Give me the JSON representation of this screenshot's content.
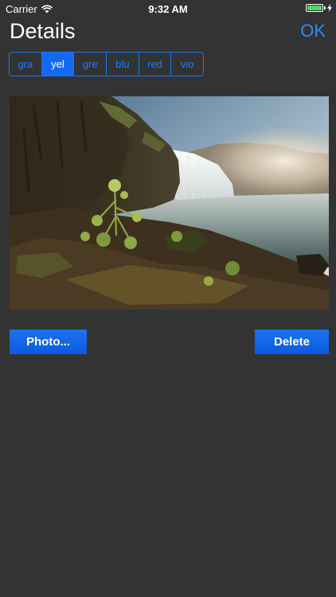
{
  "status_bar": {
    "carrier": "Carrier",
    "time": "9:32 AM",
    "battery_level": 1.0,
    "icons": [
      "wifi-icon",
      "battery-icon",
      "charging-bolt-icon"
    ]
  },
  "nav": {
    "title": "Details",
    "ok_label": "OK"
  },
  "color_segments": {
    "items": [
      "gra",
      "yel",
      "gre",
      "blu",
      "red",
      "vio"
    ],
    "selected_index": 1
  },
  "photo": {
    "subject": "waterfall landscape"
  },
  "actions": {
    "photo_label": "Photo...",
    "delete_label": "Delete"
  },
  "colors": {
    "background": "#333333",
    "accent": "#1469f2",
    "link": "#2a8cf5",
    "battery": "#4cd964"
  }
}
